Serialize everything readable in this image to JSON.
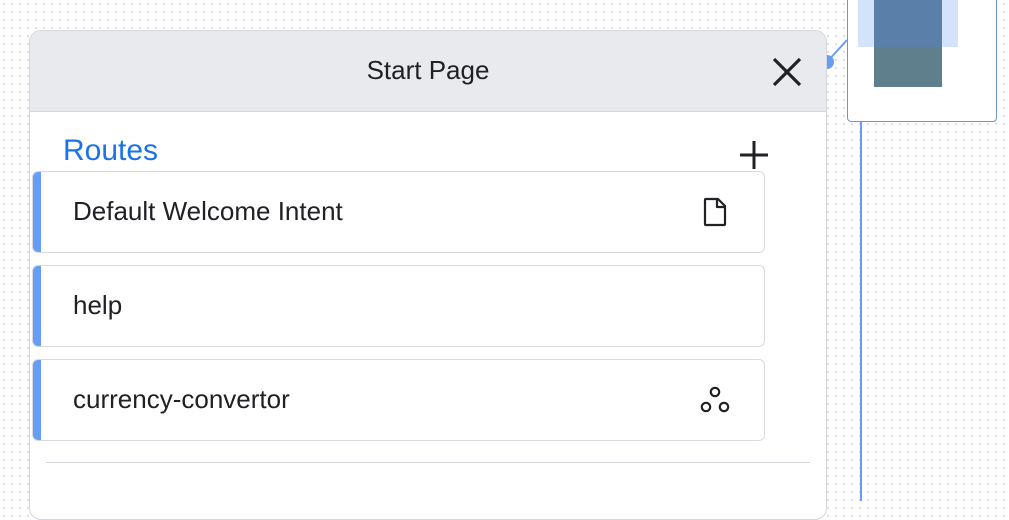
{
  "page": {
    "title": "Start Page"
  },
  "section": {
    "title": "Routes",
    "add_icon": "plus-icon",
    "close_icon": "close-icon"
  },
  "routes": [
    {
      "label": "Default Welcome Intent",
      "icon": "document-icon"
    },
    {
      "label": "help",
      "icon": ""
    },
    {
      "label": "currency-convertor",
      "icon": "webhook-icon"
    }
  ],
  "colors": {
    "accent": "#1a73e8",
    "route_bar": "#669df6",
    "header_bg": "#e9eaed",
    "connector": "#669df6"
  }
}
